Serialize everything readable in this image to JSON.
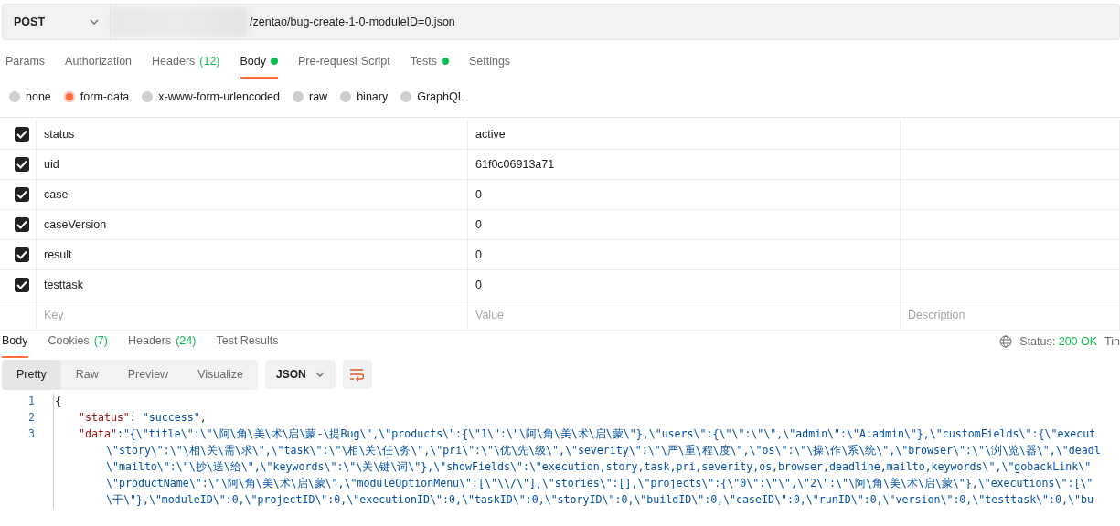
{
  "request": {
    "method": "POST",
    "url": "/zentao/bug-create-1-0-moduleID=0.json"
  },
  "request_tabs": [
    {
      "label": "Params",
      "selected": false
    },
    {
      "label": "Authorization",
      "selected": false
    },
    {
      "label": "Headers",
      "count": "(12)",
      "selected": false
    },
    {
      "label": "Body",
      "dot": true,
      "selected": true
    },
    {
      "label": "Pre-request Script",
      "selected": false
    },
    {
      "label": "Tests",
      "dot": true,
      "selected": false
    },
    {
      "label": "Settings",
      "selected": false
    }
  ],
  "body_types": [
    {
      "label": "none",
      "selected": false
    },
    {
      "label": "form-data",
      "selected": true
    },
    {
      "label": "x-www-form-urlencoded",
      "selected": false
    },
    {
      "label": "raw",
      "selected": false
    },
    {
      "label": "binary",
      "selected": false
    },
    {
      "label": "GraphQL",
      "selected": false
    }
  ],
  "params": [
    {
      "checked": true,
      "key": "status",
      "value": "active"
    },
    {
      "checked": true,
      "key": "uid",
      "value": "61f0c06913a71"
    },
    {
      "checked": true,
      "key": "case",
      "value": "0"
    },
    {
      "checked": true,
      "key": "caseVersion",
      "value": "0"
    },
    {
      "checked": true,
      "key": "result",
      "value": "0"
    },
    {
      "checked": true,
      "key": "testtask",
      "value": "0"
    }
  ],
  "new_param": {
    "key_placeholder": "Key",
    "value_placeholder": "Value",
    "description_placeholder": "Description"
  },
  "response_tabs": [
    {
      "label": "Body",
      "selected": true
    },
    {
      "label": "Cookies",
      "count": "(7)",
      "selected": false
    },
    {
      "label": "Headers",
      "count": "(24)",
      "selected": false
    },
    {
      "label": "Test Results",
      "selected": false
    }
  ],
  "status": {
    "label": "Status:",
    "value": "200 OK",
    "next": "Tin"
  },
  "view_modes": [
    {
      "label": "Pretty",
      "selected": true
    },
    {
      "label": "Raw",
      "selected": false
    },
    {
      "label": "Preview",
      "selected": false
    },
    {
      "label": "Visualize",
      "selected": false
    }
  ],
  "format": "JSON",
  "code_lines": [
    {
      "number": "1",
      "tokens": [
        {
          "kind": "punct",
          "text": "{"
        }
      ]
    },
    {
      "number": "2",
      "tokens": [
        {
          "kind": "key",
          "text": "\"status\""
        },
        {
          "kind": "punct",
          "text": ": "
        },
        {
          "kind": "string",
          "text": "\"success\""
        },
        {
          "kind": "punct",
          "text": ","
        }
      ]
    },
    {
      "number": "3",
      "tokens": [
        {
          "kind": "key",
          "text": "\"data\""
        },
        {
          "kind": "punct",
          "text": ":"
        },
        {
          "kind": "string",
          "text": "\"{\\\"title\\\":\\\"\\阿\\角\\美\\术\\启\\蒙-\\提Bug\\\",\\\"products\\\":{\\\"1\\\":\\\"\\阿\\角\\美\\术\\启\\蒙\\\"},\\\"users\\\":{\\\"\\\":\\\"\\\",\\\"admin\\\":\\\"A:admin\\\"},\\\"customFields\\\":{\\\"execut"
        }
      ]
    },
    {
      "tokens": [
        {
          "kind": "string",
          "text": "\\\"story\\\":\\\"\\相\\关\\需\\求\\\",\\\"task\\\":\\\"\\相\\关\\任\\务\\\",\\\"pri\\\":\\\"\\优\\先\\级\\\",\\\"severity\\\":\\\"\\严\\重\\程\\度\\\",\\\"os\\\":\\\"\\操\\作\\系\\统\\\",\\\"browser\\\":\\\"\\浏\\览\\器\\\",\\\"deadl"
        }
      ]
    },
    {
      "tokens": [
        {
          "kind": "string",
          "text": "\\\"mailto\\\":\\\"\\抄\\送\\给\\\",\\\"keywords\\\":\\\"\\关\\键\\词\\\"},\\\"showFields\\\":\\\"execution,story,task,pri,severity,os,browser,deadline,mailto,keywords\\\",\\\"gobackLink\\\""
        }
      ]
    },
    {
      "tokens": [
        {
          "kind": "string",
          "text": "\\\"productName\\\":\\\"\\阿\\角\\美\\术\\启\\蒙\\\",\\\"moduleOptionMenu\\\":[\\\"\\\\/\\\"],\\\"stories\\\":[],\\\"projects\\\":{\\\"0\\\":\\\"\\\",\\\"2\\\":\\\"\\阿\\角\\美\\术\\启\\蒙\\\"},\\\"executions\\\":[\\\""
        }
      ]
    },
    {
      "tokens": [
        {
          "kind": "string",
          "text": "\\干\\\"},\\\"moduleID\\\":0,\\\"projectID\\\":0,\\\"executionID\\\":0,\\\"taskID\\\":0,\\\"storyID\\\":0,\\\"buildID\\\":0,\\\"caseID\\\":0,\\\"runID\\\":0,\\\"version\\\":0,\\\"testtask\\\":0,\\\"bu"
        }
      ]
    }
  ]
}
